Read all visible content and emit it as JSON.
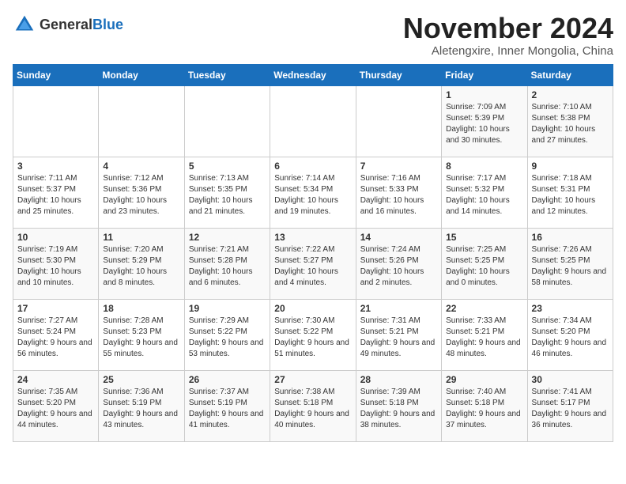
{
  "header": {
    "logo_general": "General",
    "logo_blue": "Blue",
    "month_year": "November 2024",
    "location": "Aletengxire, Inner Mongolia, China"
  },
  "days_of_week": [
    "Sunday",
    "Monday",
    "Tuesday",
    "Wednesday",
    "Thursday",
    "Friday",
    "Saturday"
  ],
  "weeks": [
    [
      {
        "day": "",
        "info": ""
      },
      {
        "day": "",
        "info": ""
      },
      {
        "day": "",
        "info": ""
      },
      {
        "day": "",
        "info": ""
      },
      {
        "day": "",
        "info": ""
      },
      {
        "day": "1",
        "info": "Sunrise: 7:09 AM\nSunset: 5:39 PM\nDaylight: 10 hours and 30 minutes."
      },
      {
        "day": "2",
        "info": "Sunrise: 7:10 AM\nSunset: 5:38 PM\nDaylight: 10 hours and 27 minutes."
      }
    ],
    [
      {
        "day": "3",
        "info": "Sunrise: 7:11 AM\nSunset: 5:37 PM\nDaylight: 10 hours and 25 minutes."
      },
      {
        "day": "4",
        "info": "Sunrise: 7:12 AM\nSunset: 5:36 PM\nDaylight: 10 hours and 23 minutes."
      },
      {
        "day": "5",
        "info": "Sunrise: 7:13 AM\nSunset: 5:35 PM\nDaylight: 10 hours and 21 minutes."
      },
      {
        "day": "6",
        "info": "Sunrise: 7:14 AM\nSunset: 5:34 PM\nDaylight: 10 hours and 19 minutes."
      },
      {
        "day": "7",
        "info": "Sunrise: 7:16 AM\nSunset: 5:33 PM\nDaylight: 10 hours and 16 minutes."
      },
      {
        "day": "8",
        "info": "Sunrise: 7:17 AM\nSunset: 5:32 PM\nDaylight: 10 hours and 14 minutes."
      },
      {
        "day": "9",
        "info": "Sunrise: 7:18 AM\nSunset: 5:31 PM\nDaylight: 10 hours and 12 minutes."
      }
    ],
    [
      {
        "day": "10",
        "info": "Sunrise: 7:19 AM\nSunset: 5:30 PM\nDaylight: 10 hours and 10 minutes."
      },
      {
        "day": "11",
        "info": "Sunrise: 7:20 AM\nSunset: 5:29 PM\nDaylight: 10 hours and 8 minutes."
      },
      {
        "day": "12",
        "info": "Sunrise: 7:21 AM\nSunset: 5:28 PM\nDaylight: 10 hours and 6 minutes."
      },
      {
        "day": "13",
        "info": "Sunrise: 7:22 AM\nSunset: 5:27 PM\nDaylight: 10 hours and 4 minutes."
      },
      {
        "day": "14",
        "info": "Sunrise: 7:24 AM\nSunset: 5:26 PM\nDaylight: 10 hours and 2 minutes."
      },
      {
        "day": "15",
        "info": "Sunrise: 7:25 AM\nSunset: 5:25 PM\nDaylight: 10 hours and 0 minutes."
      },
      {
        "day": "16",
        "info": "Sunrise: 7:26 AM\nSunset: 5:25 PM\nDaylight: 9 hours and 58 minutes."
      }
    ],
    [
      {
        "day": "17",
        "info": "Sunrise: 7:27 AM\nSunset: 5:24 PM\nDaylight: 9 hours and 56 minutes."
      },
      {
        "day": "18",
        "info": "Sunrise: 7:28 AM\nSunset: 5:23 PM\nDaylight: 9 hours and 55 minutes."
      },
      {
        "day": "19",
        "info": "Sunrise: 7:29 AM\nSunset: 5:22 PM\nDaylight: 9 hours and 53 minutes."
      },
      {
        "day": "20",
        "info": "Sunrise: 7:30 AM\nSunset: 5:22 PM\nDaylight: 9 hours and 51 minutes."
      },
      {
        "day": "21",
        "info": "Sunrise: 7:31 AM\nSunset: 5:21 PM\nDaylight: 9 hours and 49 minutes."
      },
      {
        "day": "22",
        "info": "Sunrise: 7:33 AM\nSunset: 5:21 PM\nDaylight: 9 hours and 48 minutes."
      },
      {
        "day": "23",
        "info": "Sunrise: 7:34 AM\nSunset: 5:20 PM\nDaylight: 9 hours and 46 minutes."
      }
    ],
    [
      {
        "day": "24",
        "info": "Sunrise: 7:35 AM\nSunset: 5:20 PM\nDaylight: 9 hours and 44 minutes."
      },
      {
        "day": "25",
        "info": "Sunrise: 7:36 AM\nSunset: 5:19 PM\nDaylight: 9 hours and 43 minutes."
      },
      {
        "day": "26",
        "info": "Sunrise: 7:37 AM\nSunset: 5:19 PM\nDaylight: 9 hours and 41 minutes."
      },
      {
        "day": "27",
        "info": "Sunrise: 7:38 AM\nSunset: 5:18 PM\nDaylight: 9 hours and 40 minutes."
      },
      {
        "day": "28",
        "info": "Sunrise: 7:39 AM\nSunset: 5:18 PM\nDaylight: 9 hours and 38 minutes."
      },
      {
        "day": "29",
        "info": "Sunrise: 7:40 AM\nSunset: 5:18 PM\nDaylight: 9 hours and 37 minutes."
      },
      {
        "day": "30",
        "info": "Sunrise: 7:41 AM\nSunset: 5:17 PM\nDaylight: 9 hours and 36 minutes."
      }
    ]
  ]
}
